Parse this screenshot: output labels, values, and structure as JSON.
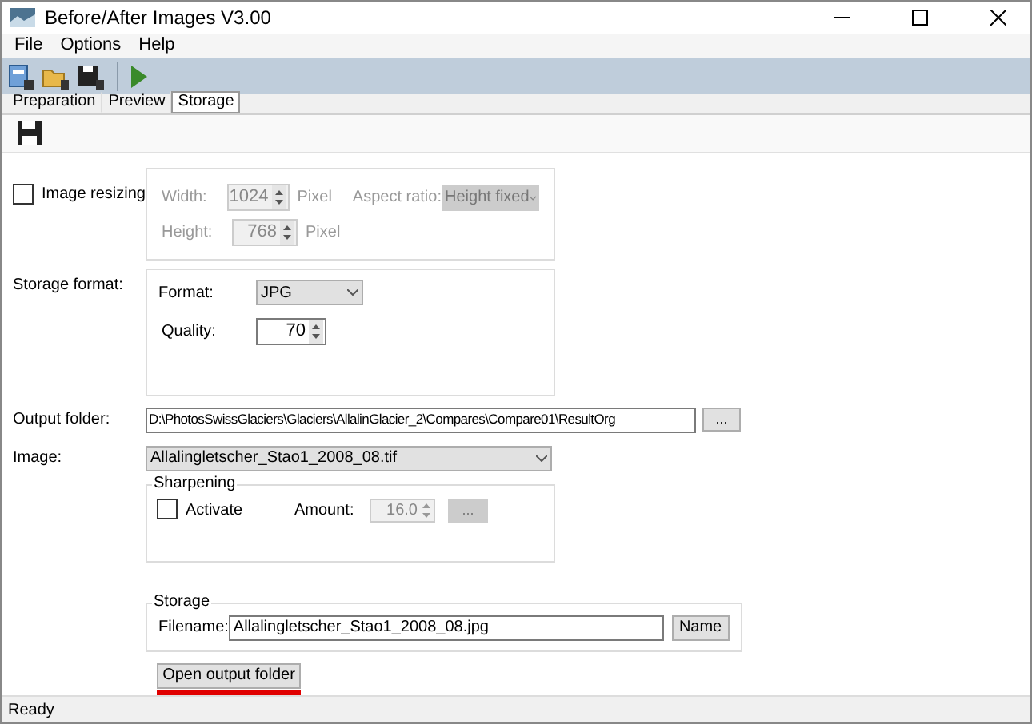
{
  "window": {
    "title": "Before/After Images V3.00"
  },
  "menu": [
    "File",
    "Options",
    "Help"
  ],
  "tabs": [
    {
      "label": "Preparation",
      "selected": false
    },
    {
      "label": "Preview",
      "selected": false
    },
    {
      "label": "Storage",
      "selected": true
    }
  ],
  "image_resizing": {
    "label": "Image resizing",
    "checked": false,
    "disabled": true,
    "width_label": "Width:",
    "width_value": "1024",
    "height_label": "Height:",
    "height_value": "768",
    "width_unit": "Pixel",
    "height_unit": "Pixel",
    "aspect_label": "Aspect ratio:",
    "aspect": "Height fixed"
  },
  "storage_format": {
    "label": "Storage format:",
    "format_label": "Format:",
    "format": "JPG",
    "quality_label": "Quality:",
    "quality": "70"
  },
  "output_folder": {
    "label": "Output folder:",
    "value": "D:\\PhotosSwissGlaciers\\Glaciers\\AllalinGlacier_2\\Compares\\Compare01\\ResultOrg",
    "browse": "..."
  },
  "image": {
    "label": "Image:",
    "value": "Allalingletscher_Stao1_2008_08.tif"
  },
  "sharpening": {
    "title": "Sharpening",
    "activate_label": "Activate",
    "checked": false,
    "amount_label": "Amount:",
    "amount": "16.0",
    "button": "...",
    "disabled": true
  },
  "storage": {
    "title": "Storage",
    "filename_label": "Filename:",
    "filename": "Allalingletscher_Stao1_2008_08.jpg",
    "name_button": "Name"
  },
  "open_button": {
    "label": "Open output folder",
    "underlined": true
  },
  "status_bar": "Ready"
}
